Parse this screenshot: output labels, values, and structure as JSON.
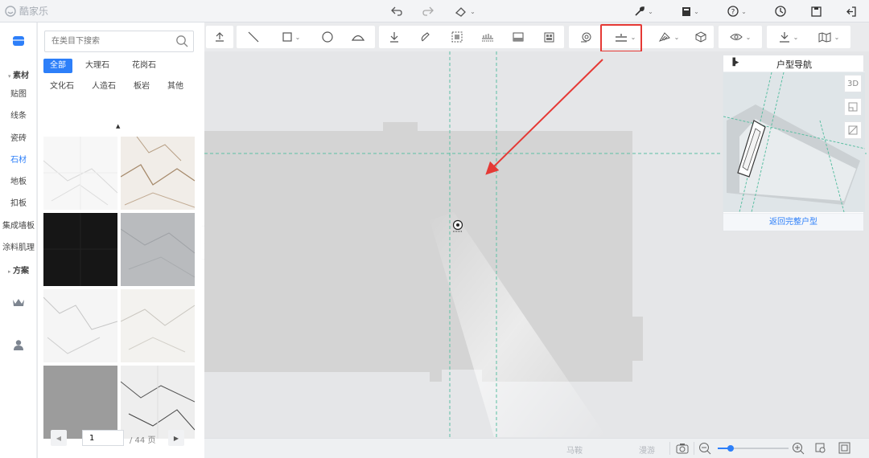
{
  "app": {
    "name": "酷家乐"
  },
  "top_bar": {
    "tools_center": [
      {
        "name": "undo-icon",
        "glyph": "↶"
      },
      {
        "name": "redo-icon",
        "glyph": "↷"
      },
      {
        "name": "eraser-icon",
        "glyph": "⌫"
      }
    ],
    "tools_right": [
      {
        "name": "wrench-icon",
        "glyph": "🔧"
      },
      {
        "name": "bookmark-icon",
        "glyph": "■"
      },
      {
        "name": "help-icon",
        "glyph": "?"
      },
      {
        "name": "history-icon",
        "glyph": "◷"
      },
      {
        "name": "save-icon",
        "glyph": "▣"
      },
      {
        "name": "exit-icon",
        "glyph": "⇥"
      }
    ]
  },
  "rail": {
    "materials_header": "素材",
    "items": [
      "贴图",
      "线条",
      "瓷砖",
      "石材",
      "地板",
      "扣板",
      "集成墙板",
      "涂料肌理"
    ],
    "active_item": "石材",
    "scheme_header": "方案"
  },
  "panel": {
    "search_placeholder": "在类目下搜索",
    "filters": [
      "全部",
      "大理石",
      "花岗石",
      "文化石",
      "人造石",
      "板岩",
      "其他"
    ],
    "active_filter": "全部",
    "pagination": {
      "current": "1",
      "total_label": "/ 44 页"
    }
  },
  "canvas_tool": {
    "selected_icon": "floor-split-icon"
  },
  "nav_panel": {
    "title": "户型导航",
    "view_3d_label": "3D",
    "back_link": "返回完整户型"
  },
  "bottom_bar": {
    "label_a": "马鞍",
    "label_b": "漫游"
  },
  "colors": {
    "accent": "#2d7ff9",
    "highlight": "#e53935",
    "guide": "#5bbfa3"
  }
}
